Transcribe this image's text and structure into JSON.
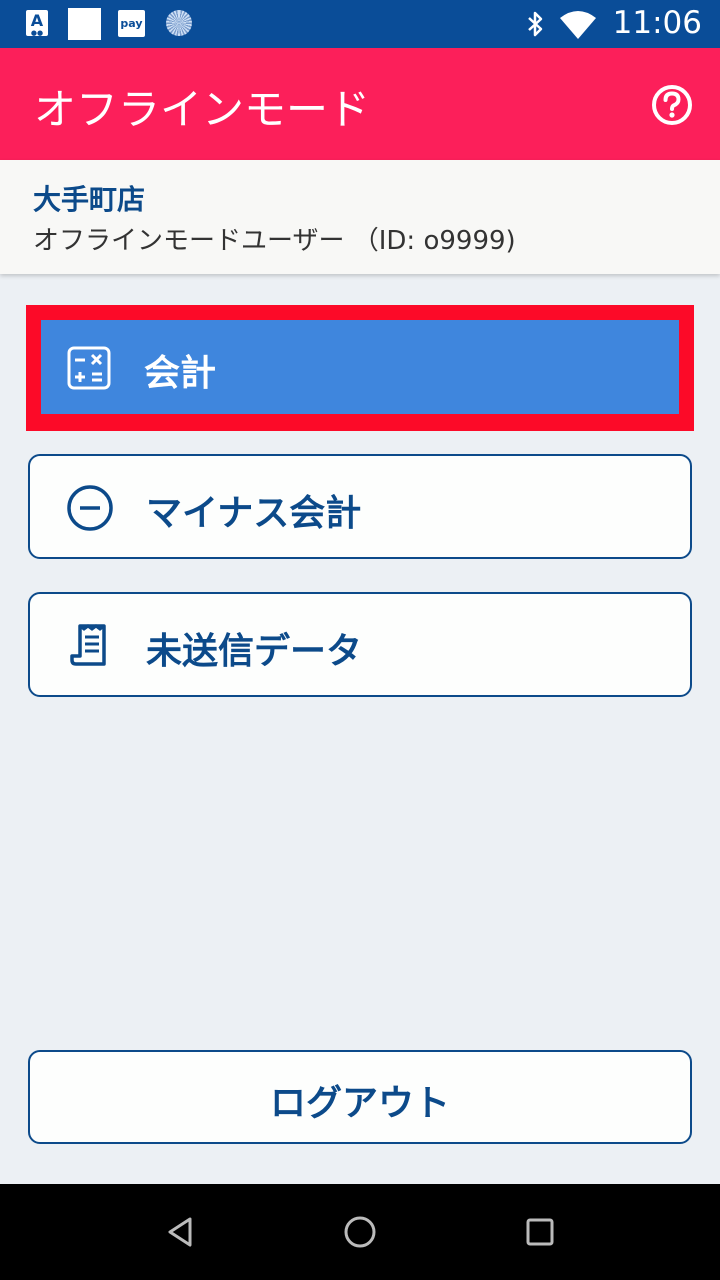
{
  "status_bar": {
    "time": "11:06",
    "icons": [
      "a-app-icon",
      "blank-app-icon",
      "pay-app-icon",
      "sync-icon",
      "bluetooth-icon",
      "wifi-icon"
    ],
    "a_label": "A",
    "pay_label": "pay"
  },
  "app_bar": {
    "title": "オフラインモード",
    "help_icon": "help-icon"
  },
  "user_panel": {
    "store_name": "大手町店",
    "user_label": "オフラインモードユーザー （ID: o9999)"
  },
  "menu": {
    "checkout": {
      "label": "会計",
      "icon": "calculator-icon"
    },
    "minus_checkout": {
      "label": "マイナス会計",
      "icon": "minus-circle-icon"
    },
    "unsent_data": {
      "label": "未送信データ",
      "icon": "receipt-icon"
    }
  },
  "logout": {
    "label": "ログアウト"
  },
  "nav_bar": {
    "icons": [
      "back-icon",
      "home-icon",
      "recent-apps-icon"
    ]
  },
  "colors": {
    "status_bar": "#0a4d98",
    "app_bar": "#fc1f5a",
    "primary_button": "#3f86dd",
    "highlight": "#fc0a28",
    "text_blue": "#0c4a8a",
    "background": "#ecf0f4"
  }
}
